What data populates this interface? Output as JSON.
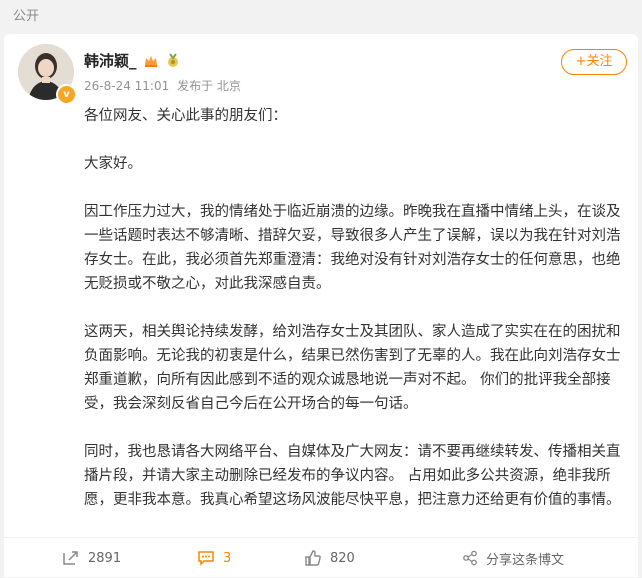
{
  "header": {
    "visibility_label": "公开"
  },
  "post": {
    "username": "韩沛颖_",
    "timestamp": "26-8-24 11:01",
    "location": "发布于 北京",
    "follow_label": "+关注",
    "paragraphs": [
      "各位网友、关心此事的朋友们：",
      "大家好。",
      "因工作压力过大，我的情绪处于临近崩溃的边缘。昨晚我在直播中情绪上头，在谈及一些话题时表达不够清晰、措辞欠妥，导致很多人产生了误解，误以为我在针对刘浩存女士。在此，我必须首先郑重澄清：我绝对没有针对刘浩存女士的任何意思，也绝无贬损或不敬之心，对此我深感自责。",
      "这两天，相关舆论持续发酵，给刘浩存女士及其团队、家人造成了实实在在的困扰和负面影响。无论我的初衷是什么，结果已然伤害到了无辜的人。我在此向刘浩存女士郑重道歉，向所有因此感到不适的观众诚恳地说一声对不起。 你们的批评我全部接受，我会深刻反省自己今后在公开场合的每一句话。",
      "同时，我也恳请各大网络平台、自媒体及广大网友：请不要再继续转发、传播相关直播片段，并请大家主动删除已经发布的争议内容。 占用如此多公共资源，绝非我所愿，更非我本意。我真心希望这场风波能尽快平息，把注意力还给更有价值的事情。"
    ]
  },
  "actions": {
    "repost_count": "2891",
    "comment_count": "3",
    "like_count": "820",
    "share_label": "分享这条博文"
  },
  "colors": {
    "accent": "#ff8200",
    "badge": "#f5a623"
  },
  "icons": [
    "avatar",
    "verified-badge-icon",
    "crown-icon",
    "medal-icon",
    "repost-icon",
    "comment-icon",
    "like-icon",
    "share-icon"
  ]
}
